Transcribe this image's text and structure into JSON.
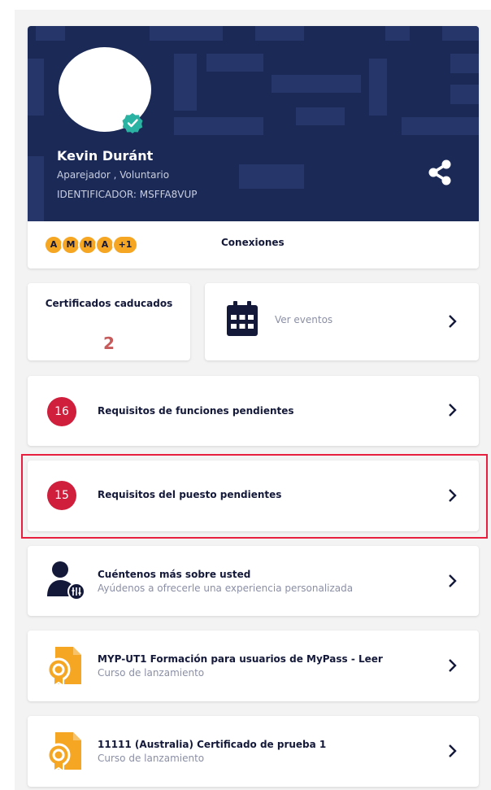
{
  "profile": {
    "name": "Kevin Duránt",
    "roles": "Aparejador , Voluntario",
    "identifier": "IDENTIFICADOR: MSFFA8VUP",
    "connections": {
      "avatars": [
        "A",
        "M",
        "M",
        "A",
        "+1"
      ],
      "label": "Conexiones"
    }
  },
  "certificates": {
    "label": "Certificados caducados",
    "count": "2"
  },
  "events": {
    "label": "Ver eventos"
  },
  "function_requirements": {
    "count": "16",
    "label": "Requisitos de funciones pendientes"
  },
  "position_requirements": {
    "count": "15",
    "label": "Requisitos del puesto pendientes"
  },
  "about_you": {
    "title": "Cuéntenos más sobre usted",
    "subtitle": "Ayúdenos a ofrecerle una experiencia personalizada"
  },
  "courses": [
    {
      "title": "MYP-UT1 Formación para usuarios de MyPass - Leer",
      "subtitle": "Curso de lanzamiento"
    },
    {
      "title": "11111 (Australia) Certificado de prueba 1",
      "subtitle": "Curso de lanzamiento"
    }
  ],
  "colors": {
    "banner": "#1b2957",
    "badge": "#cf1f3d",
    "accent_orange": "#f5a623",
    "verified": "#2ab3a3",
    "highlight": "#e8203f"
  }
}
